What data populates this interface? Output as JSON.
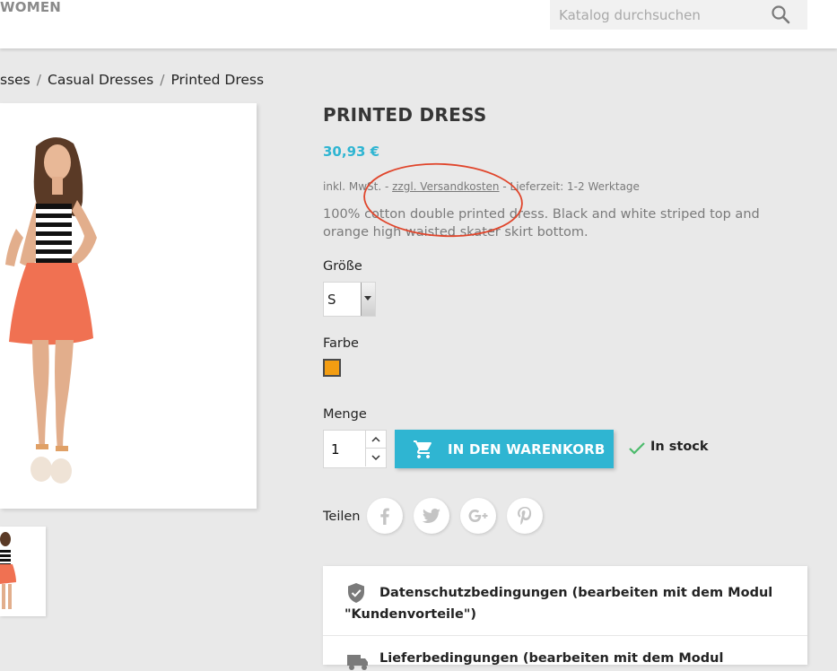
{
  "header": {
    "nav_women": "WOMEN",
    "search_placeholder": "Katalog durchsuchen"
  },
  "breadcrumb": {
    "items": [
      "sses",
      "Casual Dresses",
      "Printed Dress"
    ],
    "separator": "/"
  },
  "product": {
    "title": "PRINTED DRESS",
    "price": "30,93 €",
    "tax_prefix": "inkl. MwSt. - ",
    "shipping_link": "zzgl. Versandkosten",
    "delivery": " - Lieferzeit: 1-2 Werktage",
    "description": "100% cotton double printed dress. Black and white striped top and orange high waisted skater skirt bottom."
  },
  "options": {
    "size_label": "Größe",
    "size_value": "S",
    "color_label": "Farbe",
    "color_swatch": "#f39d12",
    "quantity_label": "Menge",
    "quantity_value": "1"
  },
  "cart": {
    "button_label": "IN DEN WARENKORB",
    "stock": "In stock"
  },
  "share": {
    "label": "Teilen",
    "networks": [
      "facebook-icon",
      "twitter-icon",
      "google-plus-icon",
      "pinterest-icon"
    ]
  },
  "reassurance": {
    "item1_line1": "Datenschutzbedingungen (bearbeiten mit dem Modul",
    "item1_line2": "\"Kundenvorteile\")",
    "item2": "Lieferbedingungen (bearbeiten mit dem Modul"
  },
  "colors": {
    "accent": "#2fb5d2",
    "annotation": "#e0452b",
    "stock_check": "#4cbb6c"
  }
}
